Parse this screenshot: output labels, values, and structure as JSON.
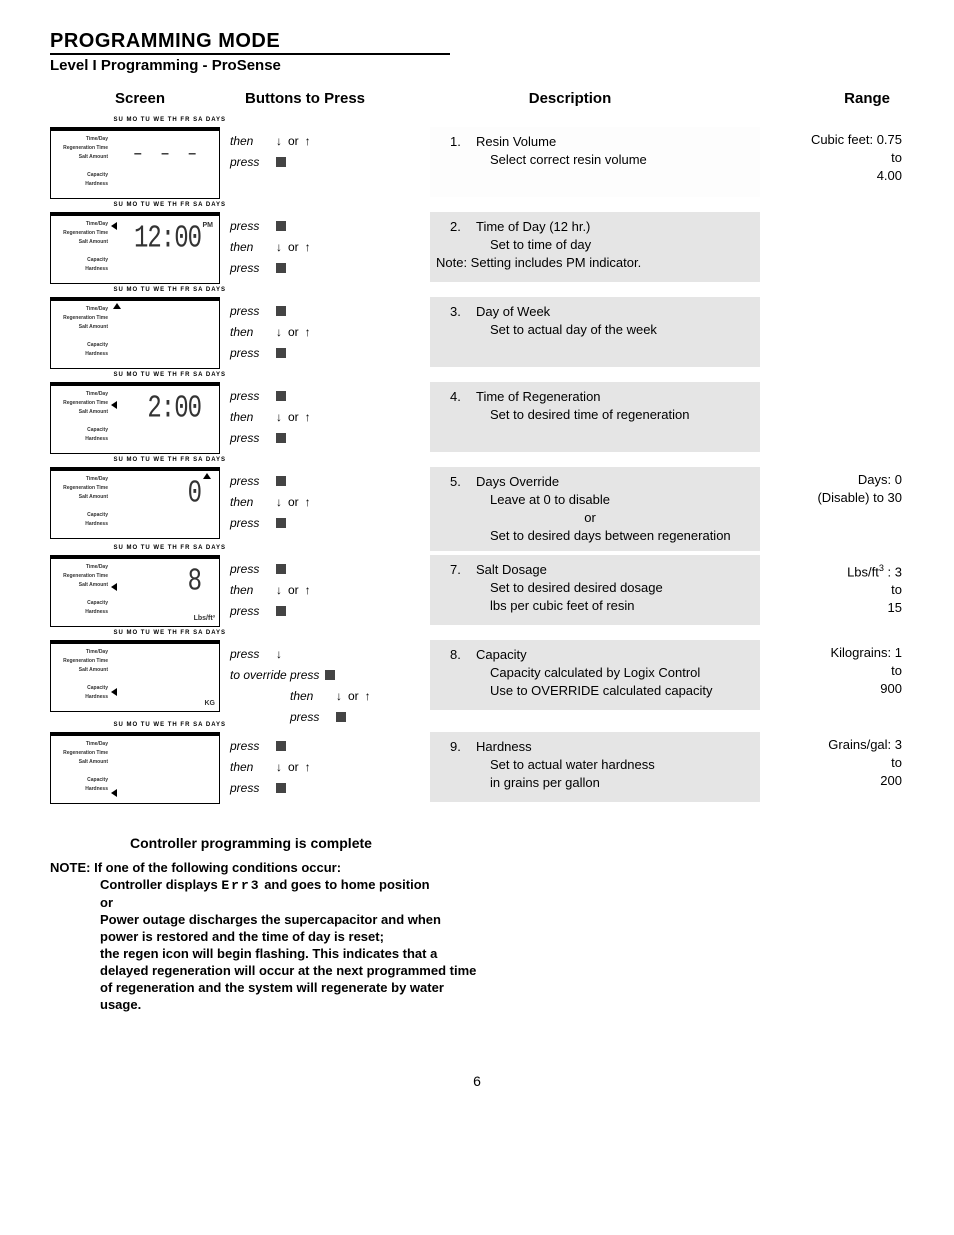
{
  "page_number": "6",
  "title": "PROGRAMMING MODE",
  "subtitle": "Level I Programming - ProSense",
  "col_headers": {
    "screen": "Screen",
    "buttons": "Buttons to Press",
    "description": "Description",
    "range": "Range"
  },
  "screen_days_label": "SU  MO  TU  WE  TH  FR  SA  DAYS",
  "screen_side_labels": "Time/Day\nRegeneration Time\nSalt Amount\n\nCapacity\nHardness",
  "words": {
    "then": "then",
    "press": "press",
    "or": "or",
    "to_override_press": "to override press"
  },
  "steps": [
    {
      "num": "1.",
      "screen_value": "– – –",
      "screen_value_class": "dashes",
      "screen_unit": "",
      "screen_pm": "",
      "arrow": "",
      "buttons_mode": "then_only",
      "desc_title": "Resin Volume",
      "desc_detail": "Select correct resin volume",
      "range_html": "Cubic feet: 0.75<br>to<br>4.00",
      "desc_bg": "light"
    },
    {
      "num": "2.",
      "screen_value": "12:00",
      "screen_value_class": "",
      "screen_unit": "",
      "screen_pm": "PM",
      "arrow": "timeday-left",
      "buttons_mode": "press_then_press",
      "desc_title": "Time of Day (12 hr.)",
      "desc_detail": "Set to time of day<br>Note: Setting includes PM indicator.",
      "desc_detail_nopad_prefix": "Note:",
      "range_html": ""
    },
    {
      "num": "3.",
      "screen_value": "",
      "screen_value_class": "",
      "screen_unit": "",
      "screen_pm": "",
      "arrow": "days-up",
      "buttons_mode": "press_then_press",
      "desc_title": "Day of Week",
      "desc_detail": "Set to actual day of the week",
      "range_html": ""
    },
    {
      "num": "4.",
      "screen_value": "2:00",
      "screen_value_class": "",
      "screen_unit": "",
      "screen_pm": "",
      "arrow": "regen-left",
      "buttons_mode": "press_then_press",
      "desc_title": "Time of Regeneration",
      "desc_detail": "Set to desired time of regeneration",
      "range_html": ""
    },
    {
      "num": "5.",
      "screen_value": "0",
      "screen_value_class": "",
      "screen_unit": "",
      "screen_pm": "",
      "arrow": "days-col-up",
      "buttons_mode": "press_then_press",
      "desc_title": "Days Override",
      "desc_detail": "Leave at 0 to disable<br><span class=\"center\">or</span>Set to desired days between regeneration",
      "range_html": "Days: 0<br>(Disable) to 30"
    },
    {
      "num": "7.",
      "screen_value": "8",
      "screen_value_class": "",
      "screen_unit": "Lbs/ft³",
      "screen_pm": "",
      "arrow": "salt-left",
      "buttons_mode": "press_then_press",
      "desc_title": "Salt Dosage",
      "desc_detail": "Set to desired desired dosage<br>lbs per cubic feet of resin",
      "range_html": "Lbs/ft<sup>3</sup> : 3<br>to<br>15"
    },
    {
      "num": "8.",
      "screen_value": "",
      "screen_value_class": "",
      "screen_unit": "KG",
      "screen_pm": "",
      "arrow": "capacity-left",
      "buttons_mode": "override",
      "desc_title": "Capacity",
      "desc_detail": "Capacity calculated by Logix Control<br>Use to OVERRIDE calculated capacity",
      "range_html": "Kilograins: 1<br>to<br>900"
    },
    {
      "num": "9.",
      "screen_value": "",
      "screen_value_class": "",
      "screen_unit": "",
      "screen_pm": "",
      "arrow": "hardness-left",
      "buttons_mode": "press_then_press",
      "desc_title": "Hardness",
      "desc_detail": "Set to actual water hardness<br>in grains per gallon",
      "range_html": "Grains/gal: 3<br>to<br>200"
    }
  ],
  "footer_heading": "Controller programming is complete",
  "note": {
    "prefix": "NOTE:",
    "line1": "If one of the following conditions occur:",
    "line2a": "Controller displays ",
    "line2_err": "Err3",
    "line2b": " and goes to home position",
    "line3": "or",
    "line4": "Power outage discharges the supercapacitor and when power is restored and the time of day is reset;",
    "line5": "the regen icon will begin flashing. This indicates that a delayed regeneration will occur at the next programmed time of regeneration and the system will regenerate by water usage."
  }
}
